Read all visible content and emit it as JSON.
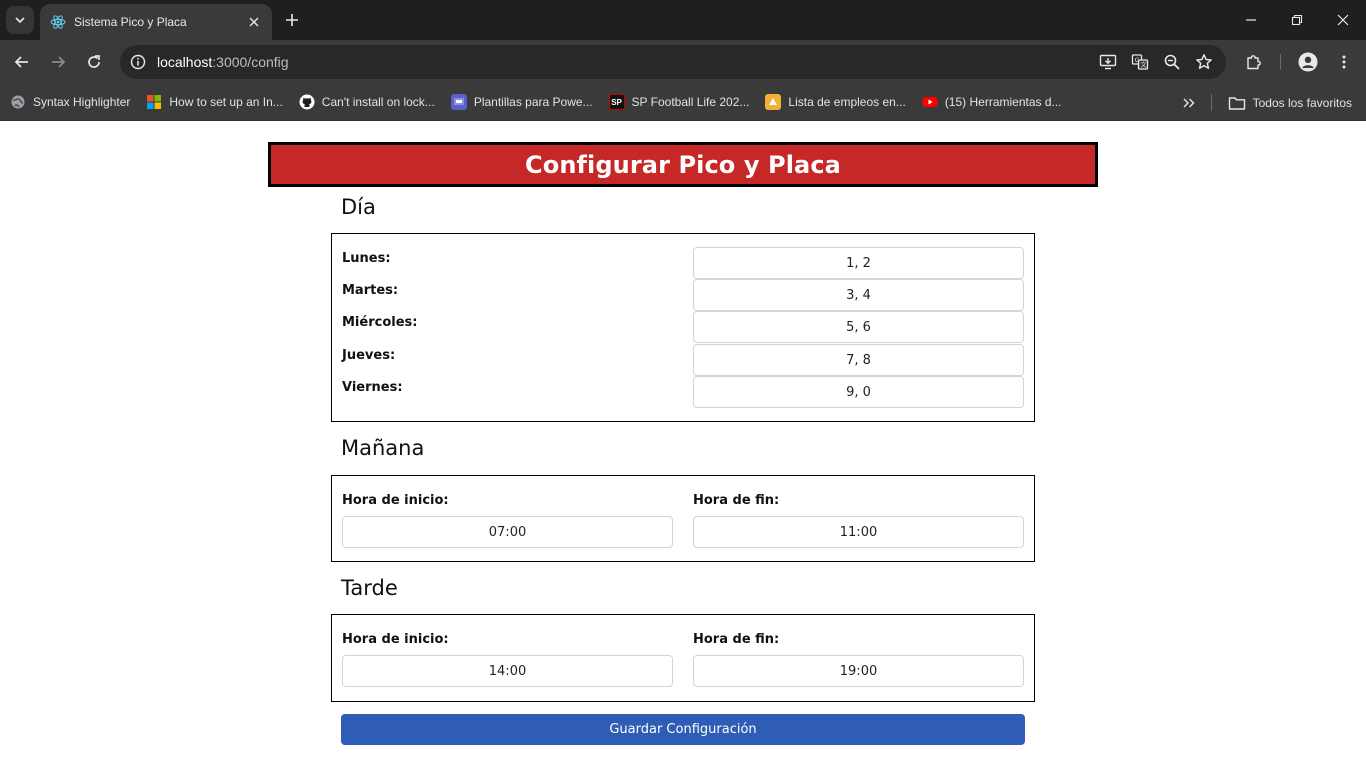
{
  "browser": {
    "tab_title": "Sistema Pico y Placa",
    "url_host": "localhost",
    "url_rest": ":3000/config",
    "bookmarks": [
      {
        "label": "Syntax Highlighter",
        "icon": "globe-icon",
        "color": "#5f6368"
      },
      {
        "label": "How to set up an In...",
        "icon": "microsoft-icon",
        "color": "#f25022"
      },
      {
        "label": "Can't install on lock...",
        "icon": "github-icon",
        "color": "#ffffff"
      },
      {
        "label": "Plantillas para Powe...",
        "icon": "slides-icon",
        "color": "#5b5fc7"
      },
      {
        "label": "SP Football Life 202...",
        "icon": "sp-icon",
        "color": "#111111"
      },
      {
        "label": "Lista de empleos en...",
        "icon": "jobs-icon",
        "color": "#f2b134"
      },
      {
        "label": "(15) Herramientas d...",
        "icon": "youtube-icon",
        "color": "#ff0000"
      }
    ],
    "all_bookmarks": "Todos los favoritos"
  },
  "page": {
    "title": "Configurar Pico y Placa",
    "accent_color": "#c62828",
    "button_color": "#2f5db6",
    "dia": {
      "heading": "Día",
      "days": [
        {
          "label": "Lunes:",
          "value": "1, 2"
        },
        {
          "label": "Martes:",
          "value": "3, 4"
        },
        {
          "label": "Miércoles:",
          "value": "5, 6"
        },
        {
          "label": "Jueves:",
          "value": "7, 8"
        },
        {
          "label": "Viernes:",
          "value": "9, 0"
        }
      ]
    },
    "manana": {
      "heading": "Mañana",
      "start_label": "Hora de inicio:",
      "start_value": "07:00",
      "end_label": "Hora de fin:",
      "end_value": "11:00"
    },
    "tarde": {
      "heading": "Tarde",
      "start_label": "Hora de inicio:",
      "start_value": "14:00",
      "end_label": "Hora de fin:",
      "end_value": "19:00"
    },
    "save_label": "Guardar Configuración"
  }
}
